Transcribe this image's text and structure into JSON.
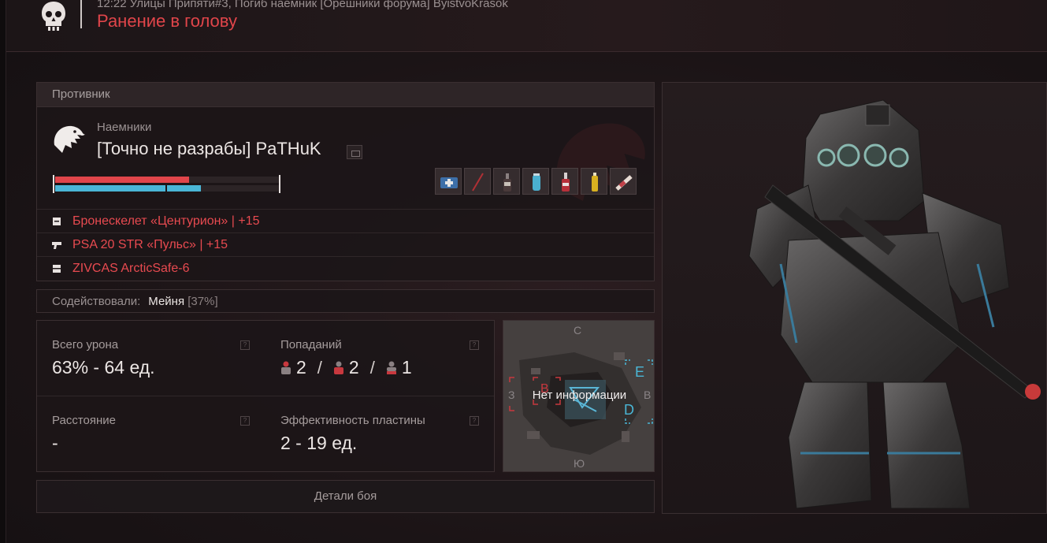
{
  "header": {
    "subtitle": "12:22 Улицы Припяти#3, Погиб наемник [Орешники форума] ByistvoKrasok",
    "title": "Ранение в голову"
  },
  "enemy": {
    "section_label": "Противник",
    "faction": "Наемники",
    "name": "[Точно не разрабы] PaTHuK",
    "hp_fraction": 0.6,
    "armor_fraction": 0.65,
    "items": [
      "medkit-icon",
      "knife-icon",
      "bottle-dark-icon",
      "spray-can-icon",
      "red-bottle-icon",
      "yellow-tube-icon",
      "syringe-icon"
    ],
    "equipment": [
      {
        "icon": "armor-icon",
        "label": "Бронескелет «Центурион» | +15"
      },
      {
        "icon": "pistol-icon",
        "label": "PSA 20 STR «Пульс» | +15"
      },
      {
        "icon": "container-icon",
        "label": "ZIVCAS ArcticSafe-6"
      }
    ]
  },
  "assist": {
    "label": "Содействовали:",
    "name": "Мейня",
    "percent": "[37%]"
  },
  "stats": {
    "total_damage_label": "Всего урона",
    "total_damage_value": "63% - 64 ед.",
    "hits_label": "Попаданий",
    "hits": [
      "2",
      "2",
      "1"
    ],
    "distance_label": "Расстояние",
    "distance_value": "-",
    "plate_label": "Эффективность пластины",
    "plate_value": "2 - 19 ед.",
    "help_glyph": "?"
  },
  "map": {
    "no_info": "Нет информации",
    "north": "С",
    "south": "Ю",
    "west": "З",
    "east": "В",
    "zone_b": "B",
    "zone_e": "E",
    "zone_d": "D"
  },
  "details_button": "Детали боя",
  "colors": {
    "accent_red": "#e0454a",
    "armor_blue": "#4ab6d6"
  }
}
